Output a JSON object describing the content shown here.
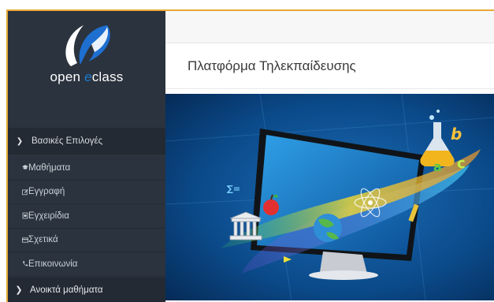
{
  "app": {
    "logo_prefix": "open ",
    "logo_e": "e",
    "logo_suffix": "class"
  },
  "sidebar": {
    "section_label": "Βασικές Επιλογές",
    "items": [
      {
        "label": "Μαθήματα",
        "icon": "graduation-cap-icon"
      },
      {
        "label": "Εγγραφή",
        "icon": "edit-icon"
      },
      {
        "label": "Εγχειρίδια",
        "icon": "document-icon"
      },
      {
        "label": "Σχετικά",
        "icon": "card-icon"
      },
      {
        "label": "Επικοινωνία",
        "icon": "phone-icon"
      }
    ],
    "open_courses_label": "Ανοικτά μαθήματα"
  },
  "main": {
    "page_title": "Πλατφόρμα Τηλεκπαίδευσης"
  },
  "colors": {
    "sidebar_bg": "#2b333e",
    "accent": "#1e7ad1",
    "banner_bg": "#0a3a6e"
  }
}
